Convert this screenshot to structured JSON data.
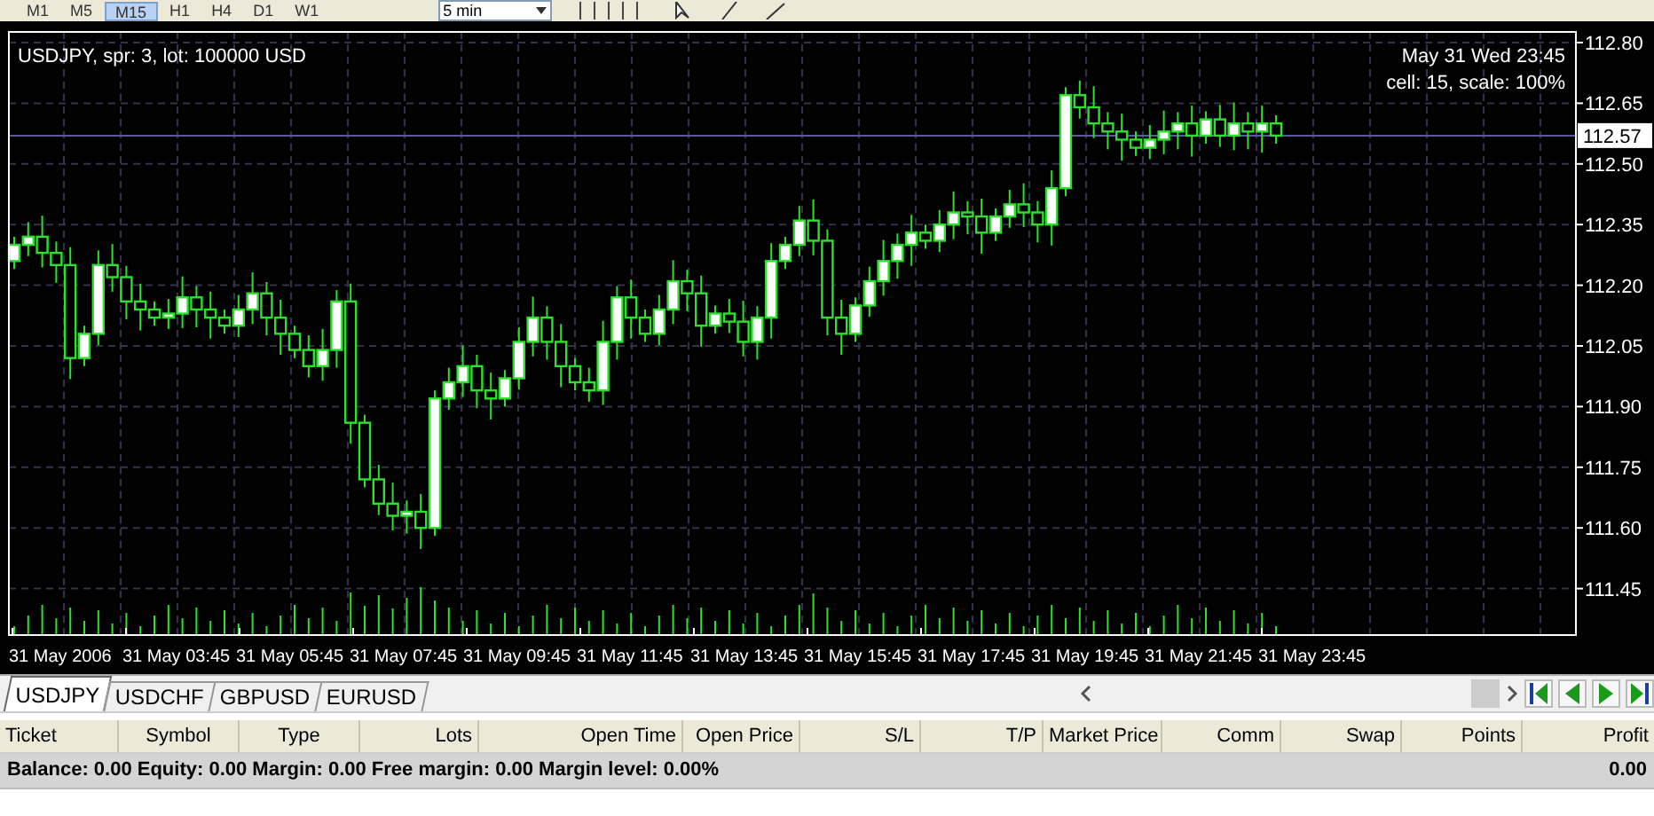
{
  "toolbar": {
    "timeframes": [
      {
        "label": "M1",
        "selected": false
      },
      {
        "label": "M5",
        "selected": false
      },
      {
        "label": "M15",
        "selected": true
      },
      {
        "label": "H1",
        "selected": false
      },
      {
        "label": "H4",
        "selected": false
      },
      {
        "label": "D1",
        "selected": false
      },
      {
        "label": "W1",
        "selected": false
      }
    ],
    "period_dropdown": "5 min"
  },
  "chart": {
    "symbol_info": "USDJPY, spr: 3, lot: 100000 USD",
    "datetime": "May 31 Wed 23:45",
    "scale_info": "cell: 15, scale: 100%",
    "price_labels": [
      "112.80",
      "112.65",
      "112.50",
      "112.35",
      "112.20",
      "112.05",
      "111.90",
      "111.75",
      "111.60",
      "111.45"
    ],
    "current_price": "112.57",
    "time_labels": [
      "31 May 2006",
      "31 May 03:45",
      "31 May 05:45",
      "31 May 07:45",
      "31 May 09:45",
      "31 May 11:45",
      "31 May 13:45",
      "31 May 15:45",
      "31 May 17:45",
      "31 May 19:45",
      "31 May 21:45",
      "31 May 23:45"
    ]
  },
  "symbol_tabs": [
    {
      "label": "USDJPY",
      "selected": true
    },
    {
      "label": "USDCHF",
      "selected": false
    },
    {
      "label": "GBPUSD",
      "selected": false
    },
    {
      "label": "EURUSD",
      "selected": false
    }
  ],
  "table": {
    "columns": [
      "Ticket",
      "Symbol",
      "Type",
      "Lots",
      "Open Time",
      "Open Price",
      "S/L",
      "T/P",
      "Market Price",
      "Comm",
      "Swap",
      "Points",
      "Profit"
    ]
  },
  "summary": {
    "text": "Balance: 0.00 Equity: 0.00 Margin: 0.00 Free margin: 0.00 Margin level: 0.00%",
    "profit": "0.00"
  }
}
